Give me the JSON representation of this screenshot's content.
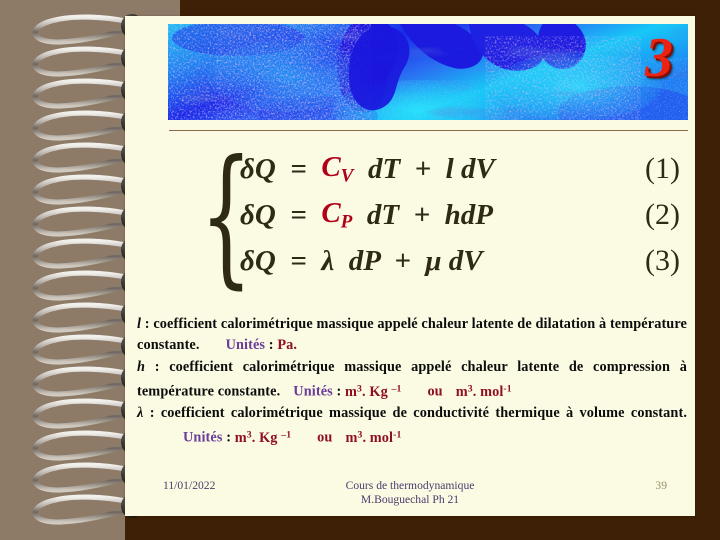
{
  "slide": {
    "banner_numeral": "3",
    "colors": {
      "frame_dark": "#3d2005",
      "frame_taupe": "#8d7a67",
      "paper": "#fbfbe4",
      "numeral_red": "#ee2211",
      "equation_ink": "#2e2a14",
      "accent_red": "#b00018",
      "unites_purple": "#6a3d9a",
      "unit_value_red": "#8f1020",
      "footer_purple": "#4d3a6a",
      "page_number": "#9a9068",
      "rule": "#8a6a4a"
    }
  },
  "equations": [
    {
      "lhs": "δQ  =  ",
      "coef": "C",
      "coef_sub": "V",
      "rhs": "  dT  +  l dV",
      "number": "(1)"
    },
    {
      "lhs": "δQ  =  ",
      "coef": "C",
      "coef_sub": "P",
      "rhs": "  dT  +  hdP",
      "number": "(2)"
    },
    {
      "lhs": "δQ  =  ",
      "coef": "λ",
      "coef_sub": "",
      "rhs": "  dP  +  μ dV",
      "number": "(3)"
    }
  ],
  "definitions": {
    "l": {
      "symbol": "l",
      "colon": " : ",
      "text": "coefficient calorimétrique massique appelé chaleur latente de dilatation à température constante.",
      "unites_label": "Unités",
      "unites_sep": " : ",
      "unit_value": "Pa."
    },
    "h": {
      "symbol": "h",
      "colon": " : ",
      "text": "coefficient calorimétrique massique appelé  chaleur latente de compression à température constante.",
      "unites_label": "Unités",
      "unites_sep": " : ",
      "unit_value_1": "m3. Kg – 1",
      "unit_or": "ou",
      "unit_value_2": "m3. mol-1"
    },
    "lambda": {
      "symbol": "λ",
      "colon": " : ",
      "text": "coefficient calorimétrique massique de conductivité thermique à volume constant.",
      "unites_label": "Unités",
      "unites_sep": " : ",
      "unit_value_1": "m3. Kg – 1",
      "unit_or": "ou",
      "unit_value_2": "m3. mol-1"
    }
  },
  "footer": {
    "date": "11/01/2022",
    "center_line1": "Cours de thermodynamique",
    "center_line2": "M.Bouguechal  Ph 21",
    "page": "39"
  }
}
